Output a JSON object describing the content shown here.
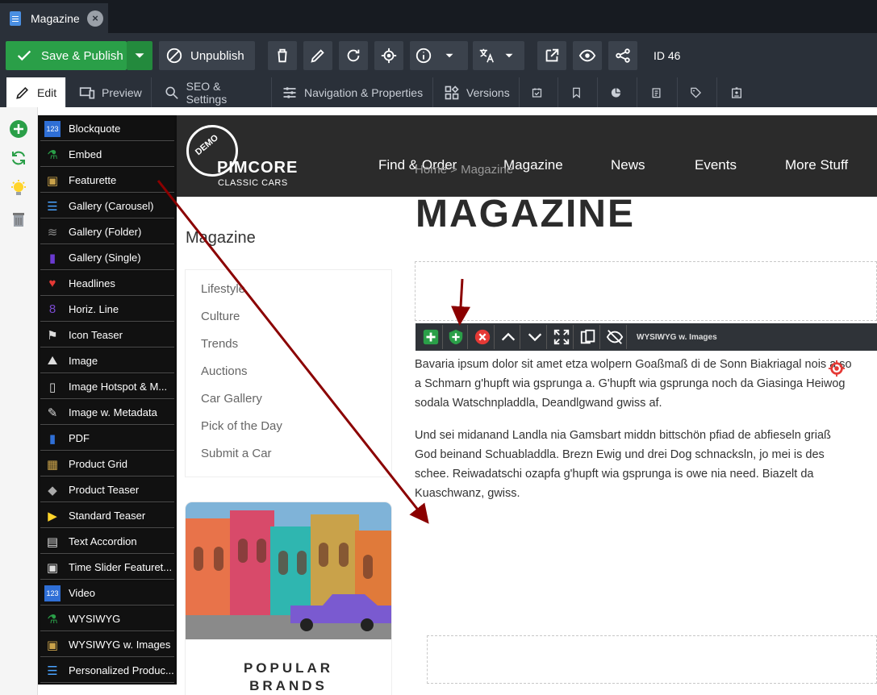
{
  "window": {
    "tab_title": "Magazine"
  },
  "toolbar": {
    "save_publish": "Save & Publish",
    "unpublish": "Unpublish",
    "id_label": "ID 46"
  },
  "tabs": [
    "Edit",
    "Preview",
    "SEO & Settings",
    "Navigation & Properties",
    "Versions"
  ],
  "blocks": [
    "Blockquote",
    "Embed",
    "Featurette",
    "Gallery (Carousel)",
    "Gallery (Folder)",
    "Gallery (Single)",
    "Headlines",
    "Horiz. Line",
    "Icon Teaser",
    "Image",
    "Image Hotspot & M...",
    "Image w. Metadata",
    "PDF",
    "Product Grid",
    "Product Teaser",
    "Standard Teaser",
    "Text Accordion",
    "Time Slider Featuret...",
    "Video",
    "WYSIWYG",
    "WYSIWYG w. Images",
    "Personalized Produc..."
  ],
  "site": {
    "logo_demo": "DEMO",
    "logo_main": "PIMCORE",
    "logo_sub": "CLASSIC CARS",
    "nav": [
      "Find & Order",
      "Magazine",
      "News",
      "Events",
      "More Stuff"
    ],
    "breadcrumb": "Home > Magazine",
    "page_title": "MAGAZINE",
    "sidebar_title": "Magazine",
    "sidebar_items": [
      "Lifestyle",
      "Culture",
      "Trends",
      "Auctions",
      "Car Gallery",
      "Pick of the Day",
      "Submit a Car"
    ],
    "card_title_1": "POPULAR",
    "card_title_2": "BRANDS",
    "editable_label": "WYSIWYG w. Images",
    "para1": "Bavaria ipsum dolor sit amet etza wolpern Goaßmaß di de Sonn Biakriagal nois a so a Schmarn g'hupft wia gsprunga a. G'hupft wia gsprunga noch da Giasinga Heiwog sodala Watschnpladdla, Deandlgwand gwiss af.",
    "para2": "Und sei midanand Landla nia Gamsbart middn bittschön pfiad de abfieseln griaß God beinand Schuabladdla. Brezn Ewig und drei Dog schnacksln, jo mei is des schee. Reiwadatschi ozapfa g'hupft wia gsprunga is owe nia need. Biazelt da Kuaschwanz, gwiss."
  },
  "colors": {
    "accent_green": "#2a9f48",
    "annotation_red": "#8b0000",
    "dark_bg": "#2a3039"
  }
}
